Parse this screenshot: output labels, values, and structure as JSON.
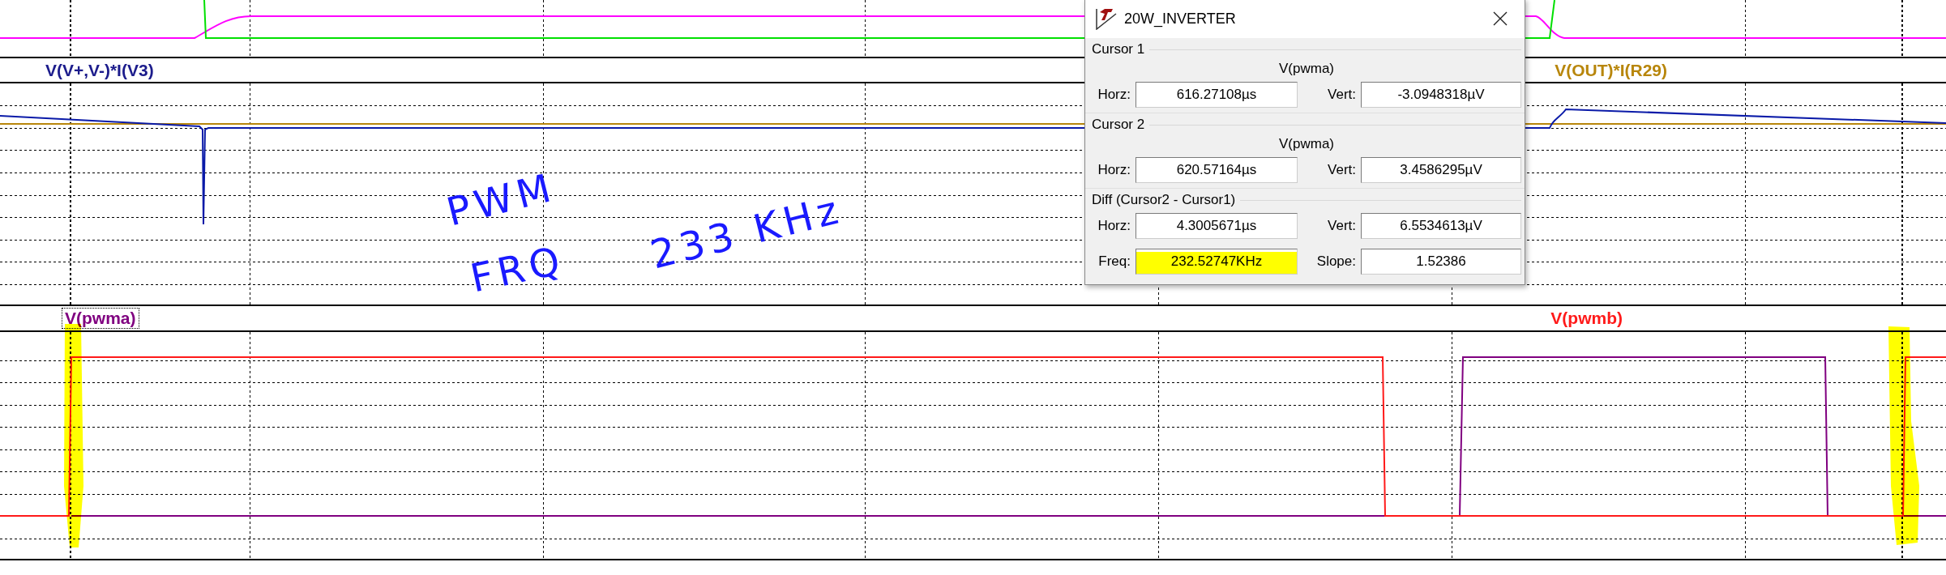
{
  "label_bands": [
    {
      "labels": [
        {
          "text": "V(V+,V-)*I(V3)",
          "color": "#1c1c8c",
          "selected": false
        },
        {
          "text": "V(OUT)*I(R29)",
          "color": "#b8860b",
          "selected": false
        }
      ]
    },
    {
      "labels": [
        {
          "text": "V(pwma)",
          "color": "#800080",
          "selected": true
        },
        {
          "text": "V(pwmb)",
          "color": "#ff1a1a",
          "selected": false
        }
      ]
    }
  ],
  "ink_notes": [
    "PWM",
    "FRQ",
    "233 KHz"
  ],
  "cursor_dialog": {
    "title": "20W_INVERTER",
    "groups": [
      {
        "title": "Cursor 1",
        "trace": "V(pwma)",
        "fields": [
          {
            "label": "Horz:",
            "value": "616.27108µs",
            "highlighted": false
          },
          {
            "label": "Vert:",
            "value": "-3.0948318µV",
            "highlighted": false
          }
        ]
      },
      {
        "title": "Cursor 2",
        "trace": "V(pwma)",
        "fields": [
          {
            "label": "Horz:",
            "value": "620.57164µs",
            "highlighted": false
          },
          {
            "label": "Vert:",
            "value": "3.4586295µV",
            "highlighted": false
          }
        ]
      },
      {
        "title": "Diff (Cursor2 - Cursor1)",
        "fields": [
          {
            "label": "Horz:",
            "value": "4.3005671µs",
            "highlighted": false
          },
          {
            "label": "Vert:",
            "value": "6.5534613µV",
            "highlighted": false
          },
          {
            "label": "Freq:",
            "value": "232.52747KHz",
            "highlighted": true
          },
          {
            "label": "Slope:",
            "value": "1.52386",
            "highlighted": false
          }
        ]
      }
    ]
  }
}
